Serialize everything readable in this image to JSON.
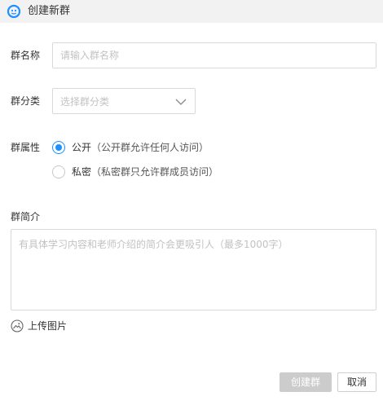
{
  "window": {
    "title": "创建新群",
    "logo_icon": "smiley-logo-icon",
    "accent": "#1e90ff"
  },
  "form": {
    "name_label": "群名称",
    "name_placeholder": "请输入群名称",
    "category_label": "群分类",
    "category_placeholder": "选择群分类",
    "property_label": "群属性",
    "options": [
      {
        "label": "公开",
        "desc": "（公开群允许任何人访问）",
        "selected": true
      },
      {
        "label": "私密",
        "desc": "（私密群只允许群成员访问）",
        "selected": false
      }
    ],
    "intro_label": "群简介",
    "intro_placeholder": "有具体学习内容和老师介绍的简介会更吸引人（最多1000字）",
    "upload_label": "上传图片"
  },
  "actions": {
    "create_label": "创建群",
    "cancel_label": "取消"
  }
}
